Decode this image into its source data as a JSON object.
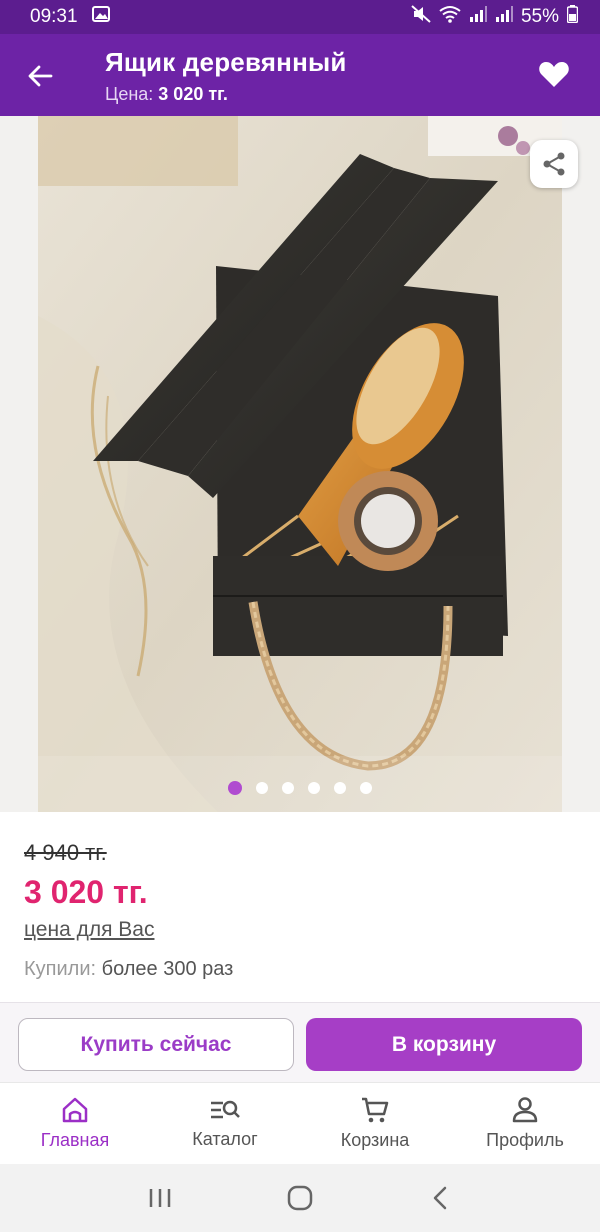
{
  "status_bar": {
    "time": "09:31",
    "battery": "55%",
    "icons": [
      "gallery-icon",
      "mute-icon",
      "wifi-icon",
      "signal-icon",
      "signal-icon",
      "battery-icon"
    ]
  },
  "header": {
    "title": "Ящик деревянный",
    "price_label": "Цена:",
    "price_value": "3 020 тг."
  },
  "gallery": {
    "slides_total": 6,
    "active_slide": 1
  },
  "price": {
    "old": "4 940 тг.",
    "current": "3 020 тг.",
    "note": "цена для Вас",
    "bought_label": "Купили:",
    "bought_value": "более 300 раз"
  },
  "actions": {
    "buy_now": "Купить сейчас",
    "add_to_cart": "В корзину"
  },
  "nav": {
    "items": [
      {
        "label": "Главная",
        "icon": "home-icon"
      },
      {
        "label": "Каталог",
        "icon": "catalog-search-icon"
      },
      {
        "label": "Корзина",
        "icon": "cart-icon"
      },
      {
        "label": "Профиль",
        "icon": "profile-icon"
      }
    ]
  },
  "colors": {
    "status_bar": "#5c1d8f",
    "header": "#6d23a6",
    "accent": "#a63ec6",
    "price": "#e0246f"
  }
}
